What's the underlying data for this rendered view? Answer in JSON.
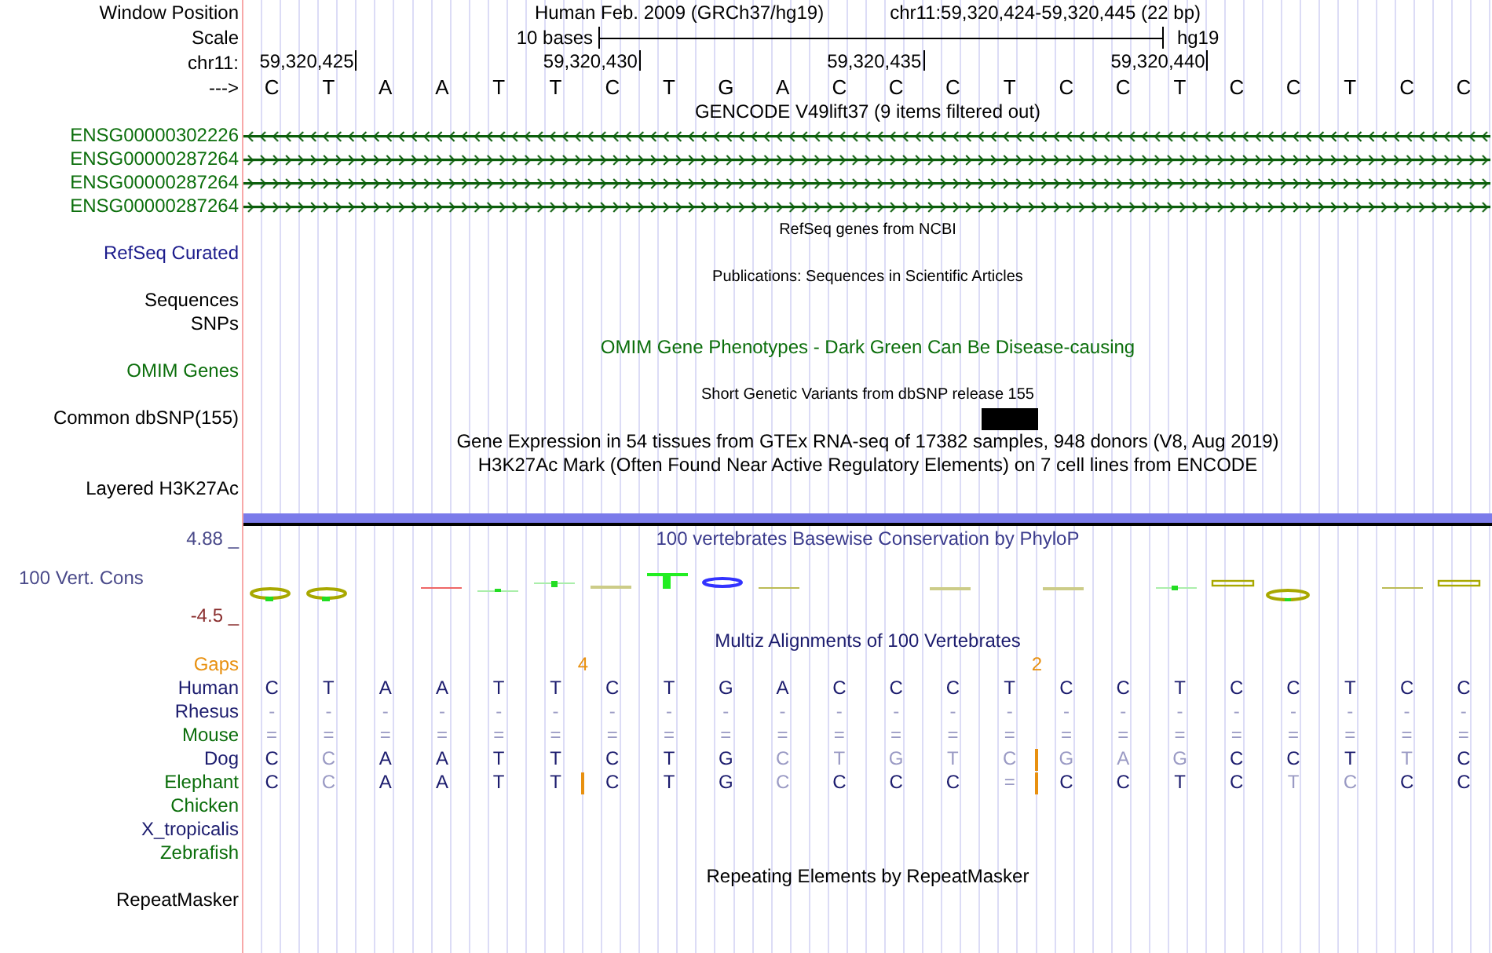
{
  "header": {
    "label": "Window Position",
    "assembly": "Human Feb. 2009 (GRCh37/hg19)",
    "position": "chr11:59,320,424-59,320,445 (22 bp)"
  },
  "scale": {
    "label": "Scale",
    "length": "10 bases",
    "assembly": "hg19"
  },
  "ruler": {
    "label": "chr11:",
    "ticks": [
      "59,320,425",
      "59,320,430",
      "59,320,435",
      "59,320,440"
    ]
  },
  "sequence": {
    "label": "--->",
    "bases": [
      "C",
      "T",
      "A",
      "A",
      "T",
      "T",
      "C",
      "T",
      "G",
      "A",
      "C",
      "C",
      "C",
      "T",
      "C",
      "C",
      "T",
      "C",
      "C",
      "T",
      "C",
      "C"
    ]
  },
  "tracks": [
    {
      "kind": "genes",
      "title": "GENCODE V49lift37 (9 items filtered out)",
      "genes": [
        {
          "name": "ENSG00000302226",
          "reverse": true
        },
        {
          "name": "ENSG00000287264",
          "reverse": false
        },
        {
          "name": "ENSG00000287264",
          "reverse": false
        },
        {
          "name": "ENSG00000287264",
          "reverse": false
        }
      ]
    },
    {
      "kind": "plain",
      "title": "RefSeq genes from NCBI",
      "small_title": true,
      "label": "RefSeq Curated",
      "color": "#1c1c8c"
    },
    {
      "kind": "plain",
      "title": "Publications: Sequences in Scientific Articles",
      "small_title": true,
      "label": "Sequences",
      "color": "#000000"
    },
    {
      "kind": "plain",
      "label": "SNPs",
      "color": "#000000"
    },
    {
      "kind": "phenotypes",
      "title": "OMIM Gene Phenotypes - Dark Green Can Be Disease-causing",
      "small_title": false,
      "label": "OMIM Genes",
      "color": "#0b6e0b"
    },
    {
      "kind": "snps",
      "title": "Short Genetic Variants from dbSNP release 155",
      "small_title": true,
      "label": "Common dbSNP(155)",
      "color": "#000000",
      "variants": [
        false,
        false,
        false,
        false,
        false,
        false,
        false,
        false,
        false,
        false,
        false,
        false,
        false,
        true,
        false,
        false,
        false,
        false,
        false,
        false,
        false,
        false
      ]
    },
    {
      "kind": "plain",
      "title": "Gene Expression in 54 tissues from GTEx RNA-seq of 17382 samples, 948 donors (V8, Aug 2019)",
      "small_title": false
    },
    {
      "kind": "signal",
      "title": "H3K27Ac Mark (Often Found Near Active Regulatory Elements) on 7 cell lines from ENCODE",
      "small_title": false,
      "label": "Layered H3K27Ac",
      "color": "#000000"
    },
    {
      "kind": "wiggle",
      "title": "100 vertebrates Basewise Conservation by PhyloP",
      "label": "100 Vert. Cons",
      "color": "#4a4a8a",
      "max": "4.88 _",
      "min": "-4.5 _"
    },
    {
      "kind": "alignment",
      "title": "Multiz Alignments of 100 Vertebrates",
      "gaps": {
        "label": "Gaps",
        "color": "#e8900f",
        "sites": [
          {
            "gap": false
          },
          {
            "gap": false
          },
          {
            "gap": false
          },
          {
            "gap": false
          },
          {
            "gap": false
          },
          {
            "gap": false
          },
          {
            "gap": true,
            "count": "4"
          },
          {
            "gap": false
          },
          {
            "gap": false
          },
          {
            "gap": false
          },
          {
            "gap": false
          },
          {
            "gap": false
          },
          {
            "gap": false
          },
          {
            "gap": false
          },
          {
            "gap": true,
            "count": "2"
          },
          {
            "gap": false
          },
          {
            "gap": false
          },
          {
            "gap": false
          },
          {
            "gap": false
          },
          {
            "gap": false
          },
          {
            "gap": false
          },
          {
            "gap": false
          }
        ]
      },
      "species": [
        {
          "name": "Human",
          "color": "#1c1c6e",
          "seq": [
            {
              "base": "C",
              "faded": false,
              "insert": false
            },
            {
              "base": "T",
              "faded": false,
              "insert": false
            },
            {
              "base": "A",
              "faded": false,
              "insert": false
            },
            {
              "base": "A",
              "faded": false,
              "insert": false
            },
            {
              "base": "T",
              "faded": false,
              "insert": false
            },
            {
              "base": "T",
              "faded": false,
              "insert": false
            },
            {
              "base": "C",
              "faded": false,
              "insert": false
            },
            {
              "base": "T",
              "faded": false,
              "insert": false
            },
            {
              "base": "G",
              "faded": false,
              "insert": false
            },
            {
              "base": "A",
              "faded": false,
              "insert": false
            },
            {
              "base": "C",
              "faded": false,
              "insert": false
            },
            {
              "base": "C",
              "faded": false,
              "insert": false
            },
            {
              "base": "C",
              "faded": false,
              "insert": false
            },
            {
              "base": "T",
              "faded": false,
              "insert": false
            },
            {
              "base": "C",
              "faded": false,
              "insert": false
            },
            {
              "base": "C",
              "faded": false,
              "insert": false
            },
            {
              "base": "T",
              "faded": false,
              "insert": false
            },
            {
              "base": "C",
              "faded": false,
              "insert": false
            },
            {
              "base": "C",
              "faded": false,
              "insert": false
            },
            {
              "base": "T",
              "faded": false,
              "insert": false
            },
            {
              "base": "C",
              "faded": false,
              "insert": false
            },
            {
              "base": "C",
              "faded": false,
              "insert": false
            }
          ]
        },
        {
          "name": "Rhesus",
          "color": "#1c1c6e",
          "seq": [
            {
              "base": "-",
              "faded": true,
              "insert": false
            },
            {
              "base": "-",
              "faded": true,
              "insert": false
            },
            {
              "base": "-",
              "faded": true,
              "insert": false
            },
            {
              "base": "-",
              "faded": true,
              "insert": false
            },
            {
              "base": "-",
              "faded": true,
              "insert": false
            },
            {
              "base": "-",
              "faded": true,
              "insert": false
            },
            {
              "base": "-",
              "faded": true,
              "insert": false
            },
            {
              "base": "-",
              "faded": true,
              "insert": false
            },
            {
              "base": "-",
              "faded": true,
              "insert": false
            },
            {
              "base": "-",
              "faded": true,
              "insert": false
            },
            {
              "base": "-",
              "faded": true,
              "insert": false
            },
            {
              "base": "-",
              "faded": true,
              "insert": false
            },
            {
              "base": "-",
              "faded": true,
              "insert": false
            },
            {
              "base": "-",
              "faded": true,
              "insert": false
            },
            {
              "base": "-",
              "faded": true,
              "insert": false
            },
            {
              "base": "-",
              "faded": true,
              "insert": false
            },
            {
              "base": "-",
              "faded": true,
              "insert": false
            },
            {
              "base": "-",
              "faded": true,
              "insert": false
            },
            {
              "base": "-",
              "faded": true,
              "insert": false
            },
            {
              "base": "-",
              "faded": true,
              "insert": false
            },
            {
              "base": "-",
              "faded": true,
              "insert": false
            },
            {
              "base": "-",
              "faded": true,
              "insert": false
            }
          ]
        },
        {
          "name": "Mouse",
          "color": "#0b6e0b",
          "seq": [
            {
              "base": "=",
              "faded": true,
              "insert": false
            },
            {
              "base": "=",
              "faded": true,
              "insert": false
            },
            {
              "base": "=",
              "faded": true,
              "insert": false
            },
            {
              "base": "=",
              "faded": true,
              "insert": false
            },
            {
              "base": "=",
              "faded": true,
              "insert": false
            },
            {
              "base": "=",
              "faded": true,
              "insert": false
            },
            {
              "base": "=",
              "faded": true,
              "insert": false
            },
            {
              "base": "=",
              "faded": true,
              "insert": false
            },
            {
              "base": "=",
              "faded": true,
              "insert": false
            },
            {
              "base": "=",
              "faded": true,
              "insert": false
            },
            {
              "base": "=",
              "faded": true,
              "insert": false
            },
            {
              "base": "=",
              "faded": true,
              "insert": false
            },
            {
              "base": "=",
              "faded": true,
              "insert": false
            },
            {
              "base": "=",
              "faded": true,
              "insert": false
            },
            {
              "base": "=",
              "faded": true,
              "insert": false
            },
            {
              "base": "=",
              "faded": true,
              "insert": false
            },
            {
              "base": "=",
              "faded": true,
              "insert": false
            },
            {
              "base": "=",
              "faded": true,
              "insert": false
            },
            {
              "base": "=",
              "faded": true,
              "insert": false
            },
            {
              "base": "=",
              "faded": true,
              "insert": false
            },
            {
              "base": "=",
              "faded": true,
              "insert": false
            },
            {
              "base": "=",
              "faded": true,
              "insert": false
            }
          ]
        },
        {
          "name": "Dog",
          "color": "#1c1c6e",
          "seq": [
            {
              "base": "C",
              "faded": false,
              "insert": false
            },
            {
              "base": "C",
              "faded": true,
              "insert": false
            },
            {
              "base": "A",
              "faded": false,
              "insert": false
            },
            {
              "base": "A",
              "faded": false,
              "insert": false
            },
            {
              "base": "T",
              "faded": false,
              "insert": false
            },
            {
              "base": "T",
              "faded": false,
              "insert": false
            },
            {
              "base": "C",
              "faded": false,
              "insert": false
            },
            {
              "base": "T",
              "faded": false,
              "insert": false
            },
            {
              "base": "G",
              "faded": false,
              "insert": false
            },
            {
              "base": "C",
              "faded": true,
              "insert": false
            },
            {
              "base": "T",
              "faded": true,
              "insert": false
            },
            {
              "base": "G",
              "faded": true,
              "insert": false
            },
            {
              "base": "T",
              "faded": true,
              "insert": false
            },
            {
              "base": "C",
              "faded": true,
              "insert": false
            },
            {
              "base": "G",
              "faded": true,
              "insert": true
            },
            {
              "base": "A",
              "faded": true,
              "insert": false
            },
            {
              "base": "G",
              "faded": true,
              "insert": false
            },
            {
              "base": "C",
              "faded": false,
              "insert": false
            },
            {
              "base": "C",
              "faded": false,
              "insert": false
            },
            {
              "base": "T",
              "faded": false,
              "insert": false
            },
            {
              "base": "T",
              "faded": true,
              "insert": false
            },
            {
              "base": "C",
              "faded": false,
              "insert": false
            }
          ]
        },
        {
          "name": "Elephant",
          "color": "#0b6e0b",
          "seq": [
            {
              "base": "C",
              "faded": false,
              "insert": false
            },
            {
              "base": "C",
              "faded": true,
              "insert": false
            },
            {
              "base": "A",
              "faded": false,
              "insert": false
            },
            {
              "base": "A",
              "faded": false,
              "insert": false
            },
            {
              "base": "T",
              "faded": false,
              "insert": false
            },
            {
              "base": "T",
              "faded": false,
              "insert": false
            },
            {
              "base": "C",
              "faded": false,
              "insert": true
            },
            {
              "base": "T",
              "faded": false,
              "insert": false
            },
            {
              "base": "G",
              "faded": false,
              "insert": false
            },
            {
              "base": "C",
              "faded": true,
              "insert": false
            },
            {
              "base": "C",
              "faded": false,
              "insert": false
            },
            {
              "base": "C",
              "faded": false,
              "insert": false
            },
            {
              "base": "C",
              "faded": false,
              "insert": false
            },
            {
              "base": "=",
              "faded": true,
              "insert": false
            },
            {
              "base": "C",
              "faded": false,
              "insert": true
            },
            {
              "base": "C",
              "faded": false,
              "insert": false
            },
            {
              "base": "T",
              "faded": false,
              "insert": false
            },
            {
              "base": "C",
              "faded": false,
              "insert": false
            },
            {
              "base": "T",
              "faded": true,
              "insert": false
            },
            {
              "base": "C",
              "faded": true,
              "insert": false
            },
            {
              "base": "C",
              "faded": false,
              "insert": false
            },
            {
              "base": "C",
              "faded": false,
              "insert": false
            }
          ]
        },
        {
          "name": "Chicken",
          "color": "#0b6e0b"
        },
        {
          "name": "X_tropicalis",
          "color": "#1c1c6e"
        },
        {
          "name": "Zebrafish",
          "color": "#0b6e0b"
        }
      ]
    },
    {
      "kind": "plain",
      "title": "Repeating Elements by RepeatMasker",
      "small_title": false,
      "label": "RepeatMasker",
      "color": "#000000"
    }
  ]
}
